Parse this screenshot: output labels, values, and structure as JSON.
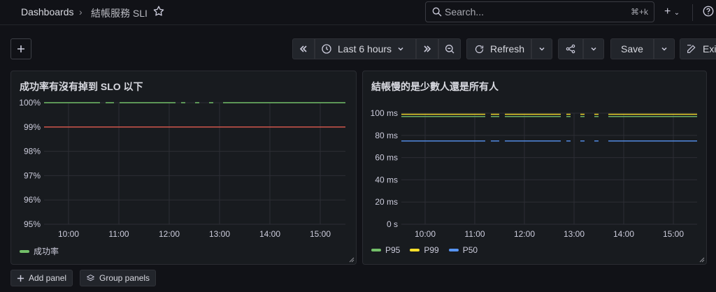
{
  "breadcrumb": {
    "root": "Dashboards",
    "separator": "›",
    "current": "結帳服務 SLI"
  },
  "search": {
    "placeholder": "Search...",
    "shortcut": "⌘+k"
  },
  "toolbar": {
    "time_range": "Last 6 hours",
    "refresh": "Refresh",
    "save": "Save",
    "exit": "Exit"
  },
  "panels": [
    {
      "title": "成功率有沒有掉到 SLO 以下",
      "legend": [
        {
          "name": "成功率",
          "color": "#73bf69"
        }
      ]
    },
    {
      "title": "結帳慢的是少數人還是所有人",
      "legend": [
        {
          "name": "P95",
          "color": "#73bf69"
        },
        {
          "name": "P99",
          "color": "#fade2a"
        },
        {
          "name": "P50",
          "color": "#5794f2"
        }
      ]
    }
  ],
  "footer": {
    "add_panel": "Add panel",
    "group_panels": "Group panels"
  },
  "chart_data": [
    {
      "type": "line",
      "title": "成功率有沒有掉到 SLO 以下",
      "y_ticks": [
        "100%",
        "99%",
        "98%",
        "97%",
        "96%",
        "95%"
      ],
      "ylim": [
        95,
        100
      ],
      "x_ticks": [
        "10:00",
        "11:00",
        "12:00",
        "13:00",
        "14:00",
        "15:00"
      ],
      "series": [
        {
          "name": "成功率",
          "color": "#73bf69",
          "values": [
            100,
            100,
            100,
            100,
            100,
            100,
            100
          ]
        },
        {
          "color": "#e05b4f",
          "values": [
            99,
            99,
            99,
            99,
            99,
            99,
            99
          ]
        }
      ]
    },
    {
      "type": "line",
      "title": "結帳慢的是少數人還是所有人",
      "y_ticks": [
        "100 ms",
        "80 ms",
        "60 ms",
        "40 ms",
        "20 ms",
        "0 s"
      ],
      "ylim": [
        0,
        100
      ],
      "x_ticks": [
        "10:00",
        "11:00",
        "12:00",
        "13:00",
        "14:00",
        "15:00"
      ],
      "series": [
        {
          "name": "P95",
          "color": "#73bf69",
          "values": [
            97,
            97,
            97,
            97,
            97,
            97,
            97
          ]
        },
        {
          "name": "P99",
          "color": "#fade2a",
          "values": [
            99,
            99,
            99,
            99,
            99,
            99,
            99
          ]
        },
        {
          "name": "P50",
          "color": "#5794f2",
          "values": [
            75,
            75,
            75,
            75,
            75,
            75,
            75
          ]
        }
      ]
    }
  ]
}
